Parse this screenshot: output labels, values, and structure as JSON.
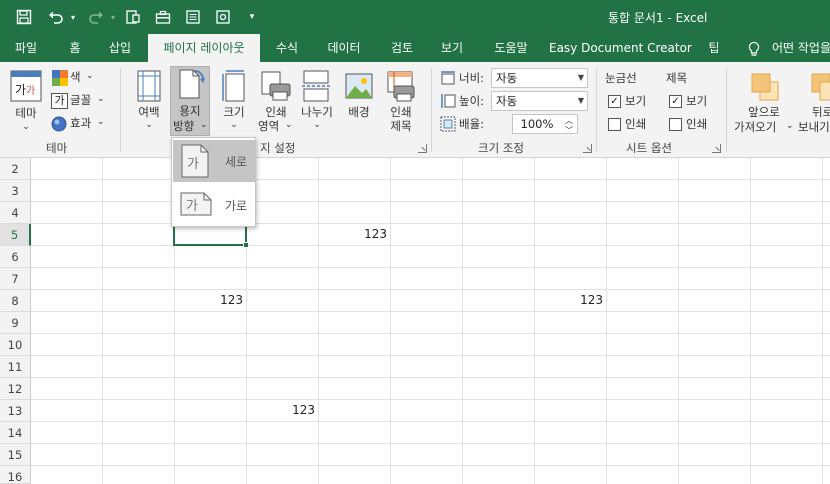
{
  "window": {
    "title": "통합 문서1  -  Excel"
  },
  "tabs": [
    "파일",
    "홈",
    "삽입",
    "페이지 레이아웃",
    "수식",
    "데이터",
    "검토",
    "보기",
    "도움말",
    "Easy Document Creator",
    "팁"
  ],
  "active_tab": "페이지 레이아웃",
  "tell_me": "어떤 작업을",
  "ribbon": {
    "theme": {
      "themes_label": "테마",
      "colors_label": "색",
      "fonts_label": "글꼴",
      "effects_label": "효과",
      "group_label": "테마"
    },
    "page_setup": {
      "margins_label": "여백",
      "orientation_label_1": "용지",
      "orientation_label_2": "방향",
      "size_label": "크기",
      "print_area_label_1": "인쇄",
      "print_area_label_2": "영역",
      "breaks_label": "나누기",
      "background_label": "배경",
      "print_titles_label_1": "인쇄",
      "print_titles_label_2": "제목",
      "group_label_visible": "지 설정"
    },
    "scale_to_fit": {
      "width_label": "너비:",
      "width_value": "자동",
      "height_label": "높이:",
      "height_value": "자동",
      "scale_label": "배율:",
      "scale_value": "100%",
      "group_label": "크기 조정"
    },
    "sheet_options": {
      "gridlines_header": "눈금선",
      "headings_header": "제목",
      "view_label": "보기",
      "print_label": "인쇄",
      "group_label": "시트 옵션",
      "gridlines_view": true,
      "gridlines_print": false,
      "headings_view": true,
      "headings_print": false
    },
    "arrange": {
      "bring_forward_1": "앞으로",
      "bring_forward_2": "가져오기",
      "send_backward_1": "뒤로",
      "send_backward_2": "보내기"
    }
  },
  "orientation_menu": {
    "items": [
      {
        "icon_glyph": "가",
        "label": "세로",
        "highlighted": true
      },
      {
        "icon_glyph": "가",
        "label": "가로",
        "highlighted": false
      }
    ]
  },
  "rows": [
    "2",
    "3",
    "4",
    "5",
    "6",
    "7",
    "8",
    "9",
    "10",
    "11",
    "12",
    "13",
    "14",
    "15",
    "16"
  ],
  "selected_row": "5",
  "cells": [
    {
      "row": "5",
      "col": "E",
      "value": "123"
    },
    {
      "row": "8",
      "col": "C",
      "value": "123"
    },
    {
      "row": "8",
      "col": "H",
      "value": "123"
    },
    {
      "row": "13",
      "col": "D",
      "value": "123"
    }
  ],
  "colors": {
    "accent": "#217346",
    "ribbon_bg": "#f3f3f3",
    "menu_highlight": "#c5c5c5"
  }
}
